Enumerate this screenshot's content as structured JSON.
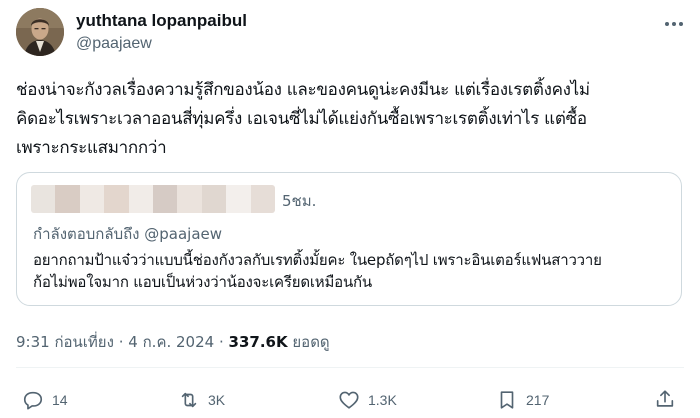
{
  "author": {
    "name": "yuthtana lopanpaibul",
    "handle": "@paajaew"
  },
  "tweet": {
    "text": "ช่องน่าจะกังวลเรื่องความรู้สึกของน้อง และของคนดูน่ะคงมีนะ  แต่เรื่องเรตติ้งคงไม่\nคิดอะไรเพราะเวลาออนสี่ทุ่มครึ่ง เอเจนซี่ไม่ได้แย่งกันซื้อเพราะเรตติ้งเท่าไร แต่ซื้อ\nเพราะกระแสมากกว่า"
  },
  "quote": {
    "time": "5ชม.",
    "reply_to": "กำลังตอบกลับถึง @paajaew",
    "text": "อยากถามป้าแจ๋วว่าแบบนี้ช่องกังวลกับเรทติ้งมั้ยคะ ในepถัดๆไป เพราะอินเตอร์แฟนสาววาย\nก้อไม่พอใจมาก แอบเป็นห่วงว่าน้องจะเครียดเหมือนกัน"
  },
  "meta": {
    "time": "9:31 ก่อนเที่ยง",
    "separator": "·",
    "date": "4 ก.ค. 2024",
    "views_count": "337.6K",
    "views_label": "ยอดดู"
  },
  "actions": {
    "replies": "14",
    "retweets": "3K",
    "likes": "1.3K",
    "bookmarks": "217"
  },
  "colors": {
    "text": "#0f1419",
    "secondary": "#536471",
    "border": "#cfd9de"
  },
  "icons": [
    "more-icon",
    "reply-icon",
    "retweet-icon",
    "like-icon",
    "bookmark-icon",
    "share-icon"
  ]
}
